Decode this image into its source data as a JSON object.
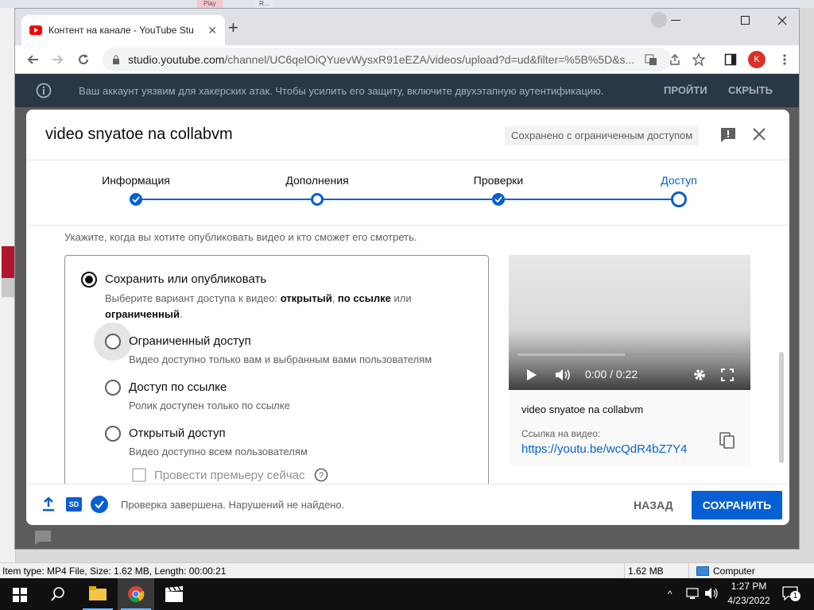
{
  "desktop": {
    "tab_a": "Play",
    "tab_b": "R...",
    "status_item": "Item type: MP4 File, Size: 1.62 MB, Length: 00:00:21",
    "status_size": "1.62 MB",
    "status_computer": "Computer"
  },
  "browser": {
    "tab_title": "Контент на канале - YouTube Stu",
    "url_host": "studio.youtube.com",
    "url_path": "/channel/UC6qelOiQYuevWysxR91eEZA/videos/upload?d=ud&filter=%5B%5D&s...",
    "profile_initial": "K"
  },
  "notice": {
    "text": "Ваш аккаунт уязвим для хакерских атак. Чтобы усилить его защиту, включите двухэтапную аутентификацию.",
    "go": "ПРОЙТИ",
    "hide": "СКРЫТЬ"
  },
  "modal": {
    "title": "video snyatoe na collabvm",
    "status_chip": "Сохранено с ограниченным доступом",
    "steps": [
      "Информация",
      "Дополнения",
      "Проверки",
      "Доступ"
    ],
    "hint": "Укажите, когда вы хотите опубликовать видео и кто сможет его смотреть.",
    "save_group": {
      "label": "Сохранить или опубликовать",
      "desc_prefix": "Выберите вариант доступа к видео: ",
      "opt1": "открытый",
      "sep1": ", ",
      "opt2": "по ссылке",
      "sep2": " или",
      "opt3": "ограниченный",
      "end": "."
    },
    "options": [
      {
        "label": "Ограниченный доступ",
        "desc": "Видео доступно только вам и выбранным вами пользователям"
      },
      {
        "label": "Доступ по ссылке",
        "desc": "Ролик доступен только по ссылке"
      },
      {
        "label": "Открытый доступ",
        "desc": "Видео доступно всем пользователям"
      }
    ],
    "premiere": "Провести премьеру сейчас",
    "preview": {
      "time": "0:00 / 0:22",
      "video_title": "video snyatoe na collabvm",
      "link_label": "Ссылка на видео:",
      "link": "https://youtu.be/wcQdR4bZ7Y4"
    },
    "footer": {
      "status": "Проверка завершена. Нарушений не найдено.",
      "hd_badge": "SD",
      "back": "НАЗАД",
      "save": "СОХРАНИТЬ"
    }
  },
  "taskbar": {
    "time": "1:27 PM",
    "date": "4/23/2022",
    "notif_count": "1"
  }
}
